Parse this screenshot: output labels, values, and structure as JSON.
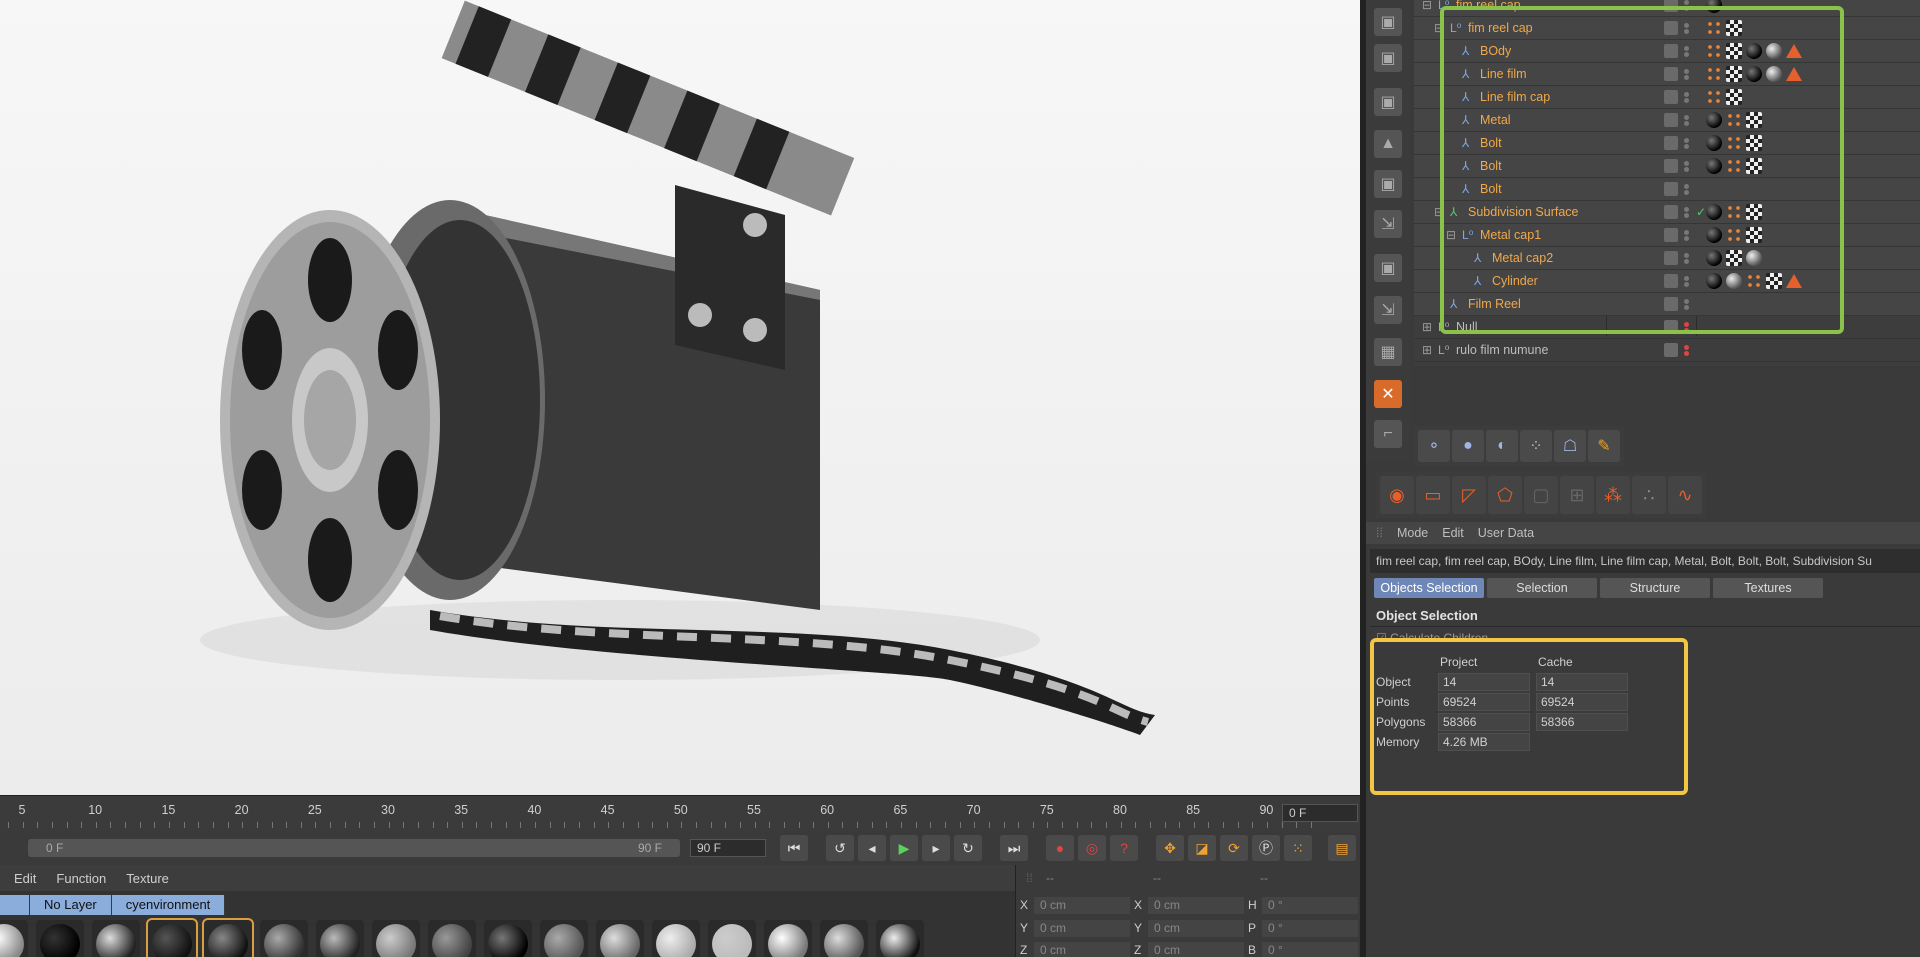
{
  "object_manager": {
    "rows": [
      {
        "name": "fim reel cap",
        "level": 0,
        "expand": "-",
        "color": "orange"
      },
      {
        "name": "fim reel cap",
        "level": 1,
        "expand": "-",
        "color": "orange"
      },
      {
        "name": "BOdy",
        "level": 2,
        "expand": "",
        "color": "orange"
      },
      {
        "name": "Line film",
        "level": 2,
        "expand": "",
        "color": "orange"
      },
      {
        "name": "Line film cap",
        "level": 2,
        "expand": "",
        "color": "orange"
      },
      {
        "name": "Metal",
        "level": 2,
        "expand": "",
        "color": "orange"
      },
      {
        "name": "Bolt",
        "level": 2,
        "expand": "",
        "color": "orange"
      },
      {
        "name": "Bolt",
        "level": 2,
        "expand": "",
        "color": "orange"
      },
      {
        "name": "Bolt",
        "level": 2,
        "expand": "",
        "color": "orange"
      },
      {
        "name": "Subdivision Surface",
        "level": 1,
        "expand": "-",
        "color": "orange"
      },
      {
        "name": "Metal cap1",
        "level": 2,
        "expand": "-",
        "color": "orange"
      },
      {
        "name": "Metal cap2",
        "level": 3,
        "expand": "",
        "color": "orange"
      },
      {
        "name": "Cylinder",
        "level": 3,
        "expand": "",
        "color": "orange"
      },
      {
        "name": "Film Reel",
        "level": 1,
        "expand": "",
        "color": "orange"
      },
      {
        "name": "Null",
        "level": 0,
        "expand": "+",
        "color": "grey"
      },
      {
        "name": "rulo film numune",
        "level": 0,
        "expand": "+",
        "color": "grey"
      }
    ]
  },
  "attributes": {
    "menu": [
      "Mode",
      "Edit",
      "User Data"
    ],
    "path": "fim reel cap, fim reel cap, BOdy, Line film, Line film cap, Metal, Bolt, Bolt, Bolt, Subdivision Su",
    "tabs": [
      "Objects Selection",
      "Selection",
      "Structure",
      "Textures"
    ],
    "section_title": "Object Selection",
    "calc_children": "Calculate Children",
    "stats": {
      "col_project": "Project",
      "col_cache": "Cache",
      "rows": [
        {
          "label": "Object",
          "project": "14",
          "cache": "14"
        },
        {
          "label": "Points",
          "project": "69524",
          "cache": "69524"
        },
        {
          "label": "Polygons",
          "project": "58366",
          "cache": "58366"
        },
        {
          "label": "Memory",
          "project": "4.26 MB",
          "cache": ""
        }
      ]
    }
  },
  "timeline": {
    "ticks": [
      "5",
      "10",
      "15",
      "20",
      "25",
      "30",
      "35",
      "40",
      "45",
      "50",
      "55",
      "60",
      "65",
      "70",
      "75",
      "80",
      "85",
      "90"
    ],
    "current_frame": "0 F",
    "slider_start": "0 F",
    "slider_end": "90 F",
    "end_frame": "90 F"
  },
  "material_manager": {
    "menu": [
      "Edit",
      "Function",
      "Texture"
    ],
    "filters": [
      "",
      "No Layer",
      "cyenvironment"
    ]
  },
  "coordinates": {
    "headers": [
      "--",
      "--",
      "--"
    ],
    "rows": [
      {
        "a": "X",
        "av": "0 cm",
        "b": "X",
        "bv": "0 cm",
        "c": "H",
        "cv": "0 °"
      },
      {
        "a": "Y",
        "av": "0 cm",
        "b": "Y",
        "bv": "0 cm",
        "c": "P",
        "cv": "0 °"
      },
      {
        "a": "Z",
        "av": "0 cm",
        "b": "Z",
        "bv": "0 cm",
        "c": "B",
        "cv": "0 °"
      }
    ]
  },
  "colors": {
    "object_name": "#f0a84a",
    "selection_highlight": "#8bc34a",
    "stats_highlight": "#f2c744",
    "tab_active": "#6e87b6",
    "filter_bg": "#8aaddc"
  }
}
